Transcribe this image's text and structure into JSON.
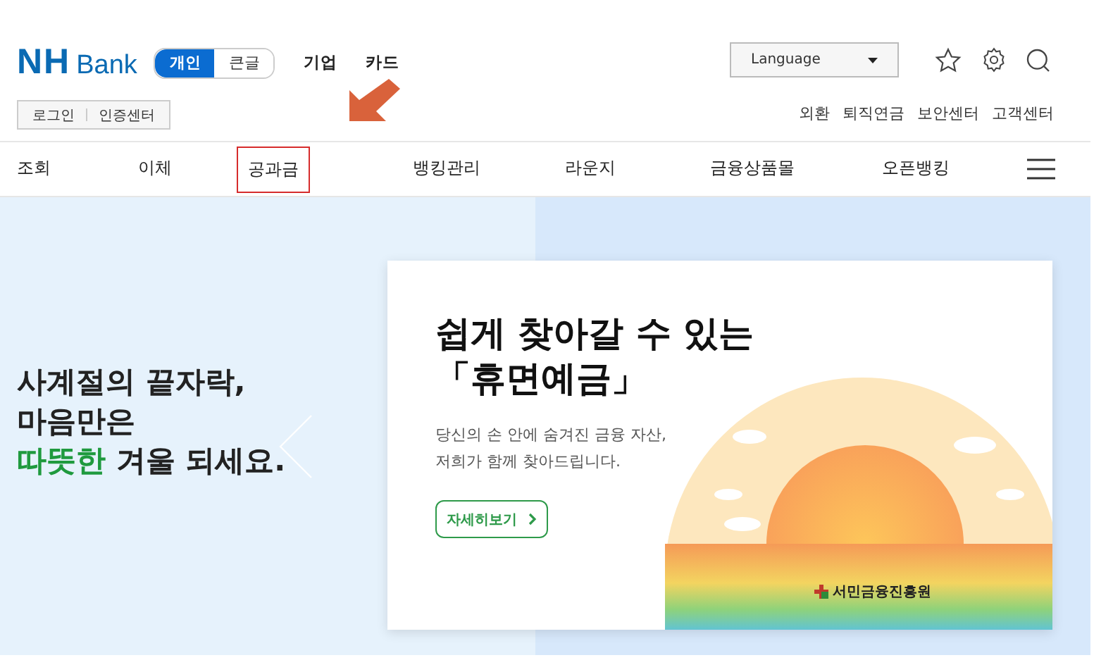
{
  "header": {
    "logo": {
      "mark": "NH",
      "word": "Bank"
    },
    "modes": [
      {
        "label": "개인",
        "selected": true
      },
      {
        "label": "큰글",
        "selected": false
      }
    ],
    "segments": [
      "기업",
      "카드"
    ],
    "auth_links": [
      "로그인",
      "인증센터"
    ],
    "language": {
      "value": "Language"
    },
    "utility_links": [
      "외환",
      "퇴직연금",
      "보안센터",
      "고객센터"
    ]
  },
  "nav": {
    "items": [
      {
        "label": "조회",
        "highlighted": false
      },
      {
        "label": "이체",
        "highlighted": false
      },
      {
        "label": "공과금",
        "highlighted": true
      },
      {
        "label": "뱅킹관리",
        "highlighted": false
      },
      {
        "label": "라운지",
        "highlighted": false
      },
      {
        "label": "금융상품몰",
        "highlighted": false
      },
      {
        "label": "오픈뱅킹",
        "highlighted": false
      }
    ]
  },
  "hero": {
    "lines": [
      "사계절의 끝자락,",
      "마음만은"
    ],
    "accent": "따뜻한",
    "tail": "겨울 되세요.",
    "card": {
      "title_lines": [
        "쉽게 찾아갈 수 있는",
        "「휴면예금」"
      ],
      "body_lines": [
        "당신의 손 안에 숨겨진 금융 자산,",
        "저희가 함께 찾아드립니다."
      ],
      "button": "자세히보기",
      "sponsor": "서민금융진흥원"
    }
  }
}
